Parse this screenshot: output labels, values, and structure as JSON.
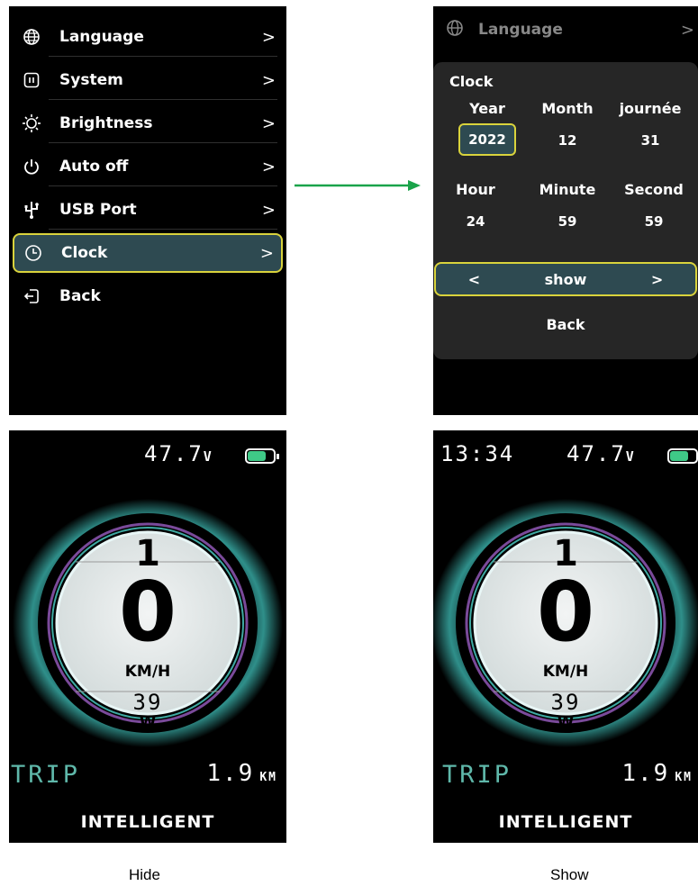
{
  "menu": {
    "items": [
      {
        "label": "Language",
        "icon": "globe-icon",
        "chevron": ">"
      },
      {
        "label": "System",
        "icon": "system-icon",
        "chevron": ">"
      },
      {
        "label": "Brightness",
        "icon": "sun-icon",
        "chevron": ">"
      },
      {
        "label": "Auto off",
        "icon": "power-icon",
        "chevron": ">"
      },
      {
        "label": "USB Port",
        "icon": "usb-icon",
        "chevron": ">"
      },
      {
        "label": "Clock",
        "icon": "clock-icon",
        "chevron": ">",
        "selected": true
      },
      {
        "label": "Back",
        "icon": "back-icon",
        "chevron": ""
      }
    ]
  },
  "clock_screen": {
    "top_item": {
      "label": "Language",
      "chevron": ">"
    },
    "title": "Clock",
    "date_headers": [
      "Year",
      "Month",
      "journée"
    ],
    "date_values": [
      "2022",
      "12",
      "31"
    ],
    "time_headers": [
      "Hour",
      "Minute",
      "Second"
    ],
    "time_values": [
      "24",
      "59",
      "59"
    ],
    "selector": {
      "left": "<",
      "value": "show",
      "right": ">"
    },
    "back": "Back"
  },
  "dash_hide": {
    "voltage": "47.7",
    "voltage_unit": "V",
    "assist_level": "1",
    "speed": "0",
    "speed_unit": "KM/H",
    "power": "39",
    "power_unit": "W",
    "trip_label": "TRIP",
    "trip_value": "1.9",
    "trip_unit": "KM",
    "mode": "INTELLIGENT"
  },
  "dash_show": {
    "time": "13:34",
    "voltage": "47.7",
    "voltage_unit": "V",
    "assist_level": "1",
    "speed": "0",
    "speed_unit": "KM/H",
    "power": "39",
    "power_unit": "W",
    "trip_label": "TRIP",
    "trip_value": "1.9",
    "trip_unit": "KM",
    "mode": "INTELLIGENT"
  },
  "captions": {
    "hide": "Hide",
    "show": "Show"
  },
  "colors": {
    "accent_yellow": "#d9d33c",
    "selected_bg": "#2e4a51",
    "arrow_green": "#1aa34a",
    "trip_teal": "#5fb8aa",
    "battery_green": "#3fc987"
  }
}
